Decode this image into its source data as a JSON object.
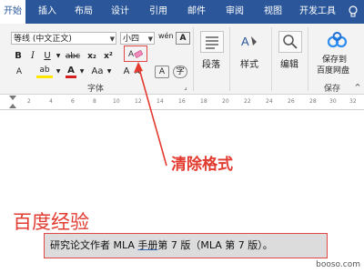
{
  "tabs": [
    "开始",
    "插入",
    "布局",
    "设计",
    "引用",
    "邮件",
    "审阅",
    "视图",
    "开发工具"
  ],
  "font": {
    "name": "等线 (中文正文)",
    "size": "小四",
    "bold": "B",
    "italic": "I",
    "underline": "U",
    "strike": "abc",
    "subscript": "x₂",
    "superscript": "x²",
    "highlight": "ab",
    "font_color": "A",
    "case": "Aa",
    "grow": "A",
    "shrink": "A",
    "wen": "wén",
    "group_label": "字体"
  },
  "groups": {
    "paragraph": "段落",
    "styles": "样式",
    "editing": "编辑",
    "save_label_1": "保存到",
    "save_label_2": "百度网盘",
    "save_group": "保存"
  },
  "ruler_ticks": [
    "2",
    "4",
    "6",
    "8",
    "10",
    "12",
    "14",
    "16",
    "18",
    "20",
    "22",
    "24",
    "26",
    "28",
    "30",
    "32"
  ],
  "annotation": "清除格式",
  "watermark": "百度经验",
  "document": {
    "before": "研究论文作者 MLA ",
    "linked": "手册",
    "after": "第 7 版（MLA 第 7 版）。"
  },
  "corner_text": "booso.com",
  "colors": {
    "tab_bar": "#2b579a",
    "annotation": "#e23a2f",
    "highlight": "#ffe600",
    "font_color": "#d42020"
  }
}
